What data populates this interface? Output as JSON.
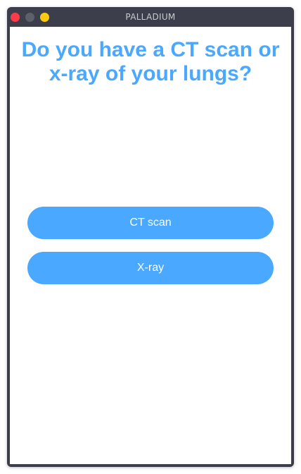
{
  "window": {
    "title": "PALLADIUM"
  },
  "question": {
    "heading": "Do you have a CT scan or x-ray of your lungs?"
  },
  "options": [
    {
      "label": "CT scan"
    },
    {
      "label": "X-ray"
    }
  ],
  "colors": {
    "accent": "#4aa8ff",
    "titlebar": "#3c3f4b"
  }
}
